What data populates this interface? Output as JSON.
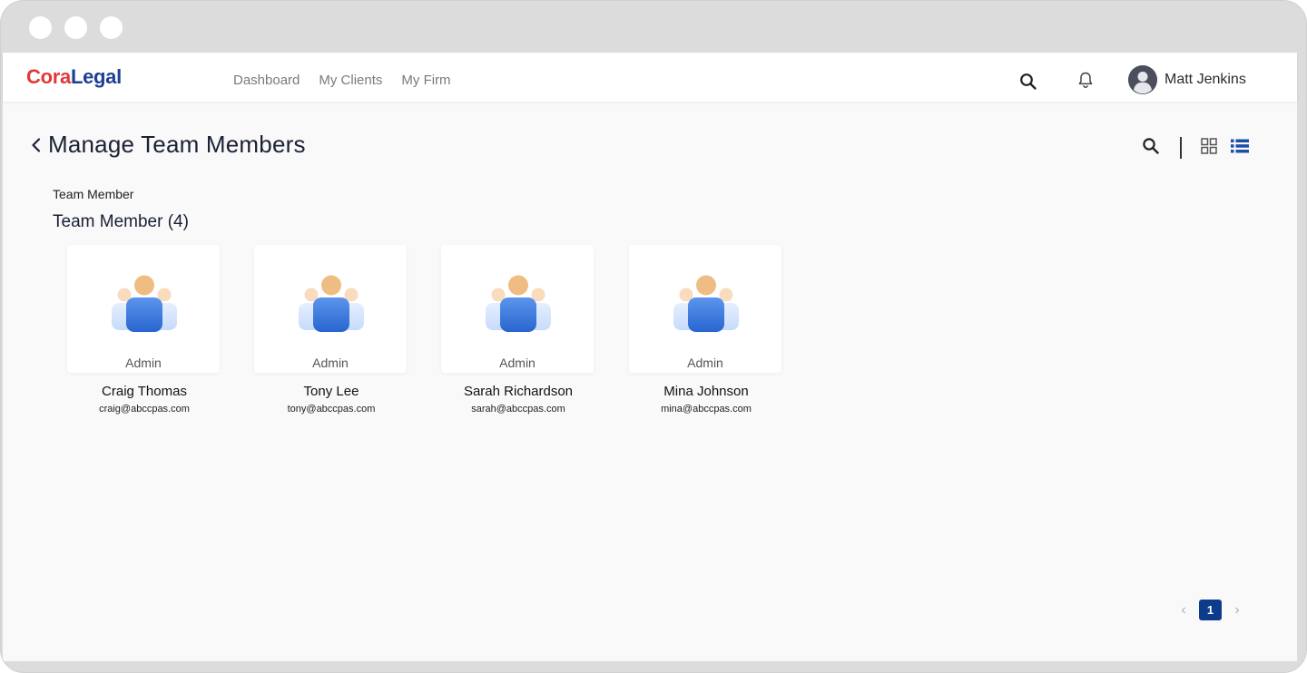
{
  "brand": {
    "part1": "Cora",
    "part2": "Legal",
    "color1": "#e03a3a",
    "color2": "#1d3f93"
  },
  "nav": {
    "items": [
      "Dashboard",
      "My Clients",
      "My Firm"
    ]
  },
  "user": {
    "name": "Matt Jenkins"
  },
  "page": {
    "title": "Manage Team Members"
  },
  "section": {
    "label": "Team Member",
    "heading": "Team Member (4)"
  },
  "members": [
    {
      "name": "Craig Thomas",
      "email": "craig@abccpas.com",
      "role": "Admin"
    },
    {
      "name": "Tony Lee",
      "email": "tony@abccpas.com",
      "role": "Admin"
    },
    {
      "name": "Sarah Richardson",
      "email": "sarah@abccpas.com",
      "role": "Admin"
    },
    {
      "name": "Mina Johnson",
      "email": "mina@abccpas.com",
      "role": "Admin"
    }
  ],
  "pagination": {
    "current": "1",
    "prev": "‹",
    "next": "›"
  },
  "icons": [
    "back-icon",
    "search-icon",
    "bell-icon",
    "grid-view-icon",
    "list-view-icon",
    "team-icon"
  ]
}
